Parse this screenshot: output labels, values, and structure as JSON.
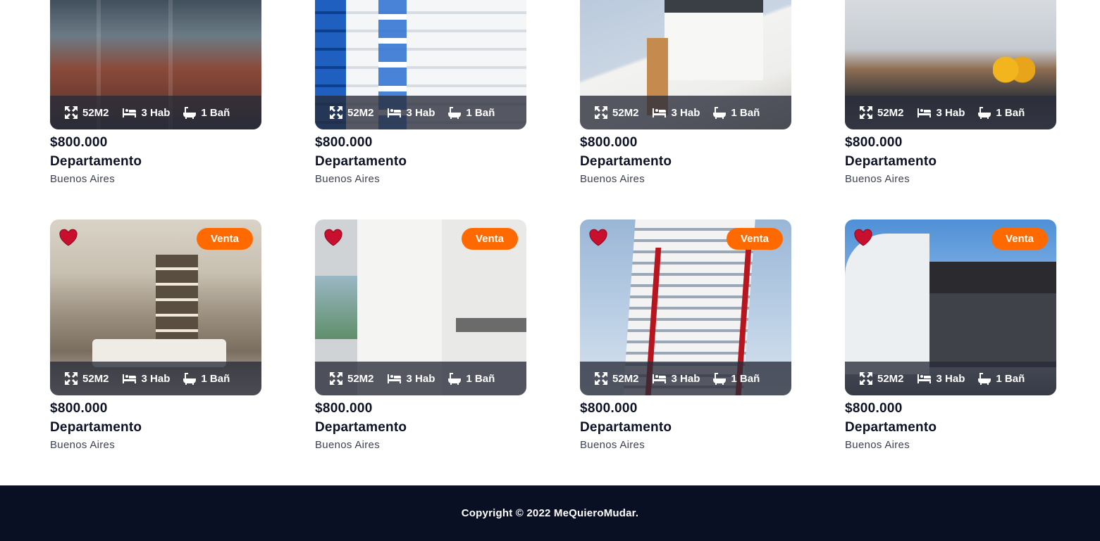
{
  "listings": [
    {
      "price": "$800.000",
      "type": "Departamento",
      "location": "Buenos Aires",
      "area": "52M2",
      "rooms": "3 Hab",
      "baths": "1 Bañ",
      "image": "apartment-building-exterior"
    },
    {
      "price": "$800.000",
      "type": "Departamento",
      "location": "Buenos Aires",
      "area": "52M2",
      "rooms": "3 Hab",
      "baths": "1 Bañ",
      "image": "blue-balcony-tower"
    },
    {
      "price": "$800.000",
      "type": "Departamento",
      "location": "Buenos Aires",
      "area": "52M2",
      "rooms": "3 Hab",
      "baths": "1 Bañ",
      "image": "white-house"
    },
    {
      "price": "$800.000",
      "type": "Departamento",
      "location": "Buenos Aires",
      "area": "52M2",
      "rooms": "3 Hab",
      "baths": "1 Bañ",
      "image": "living-room-yellow-pillows"
    },
    {
      "price": "$800.000",
      "type": "Departamento",
      "location": "Buenos Aires",
      "area": "52M2",
      "rooms": "3 Hab",
      "baths": "1 Bañ",
      "badge": "Venta",
      "image": "interior-living-room"
    },
    {
      "price": "$800.000",
      "type": "Departamento",
      "location": "Buenos Aires",
      "area": "52M2",
      "rooms": "3 Hab",
      "baths": "1 Bañ",
      "badge": "Venta",
      "image": "white-kitchen"
    },
    {
      "price": "$800.000",
      "type": "Departamento",
      "location": "Buenos Aires",
      "area": "52M2",
      "rooms": "3 Hab",
      "baths": "1 Bañ",
      "badge": "Venta",
      "image": "red-white-highrise"
    },
    {
      "price": "$800.000",
      "type": "Departamento",
      "location": "Buenos Aires",
      "area": "52M2",
      "rooms": "3 Hab",
      "baths": "1 Bañ",
      "badge": "Venta",
      "image": "modern-dark-house"
    }
  ],
  "icons": {
    "area": "expand-arrows-icon",
    "rooms": "bed-icon",
    "baths": "bathtub-icon",
    "favorite": "heart-icon"
  },
  "colors": {
    "badge": "#ff6a00",
    "heart": "#c8102e",
    "footer_bg": "#0a1024",
    "text": "#0c1124"
  },
  "footer": {
    "copyright": "Copyright © 2022 MeQuieroMudar."
  }
}
